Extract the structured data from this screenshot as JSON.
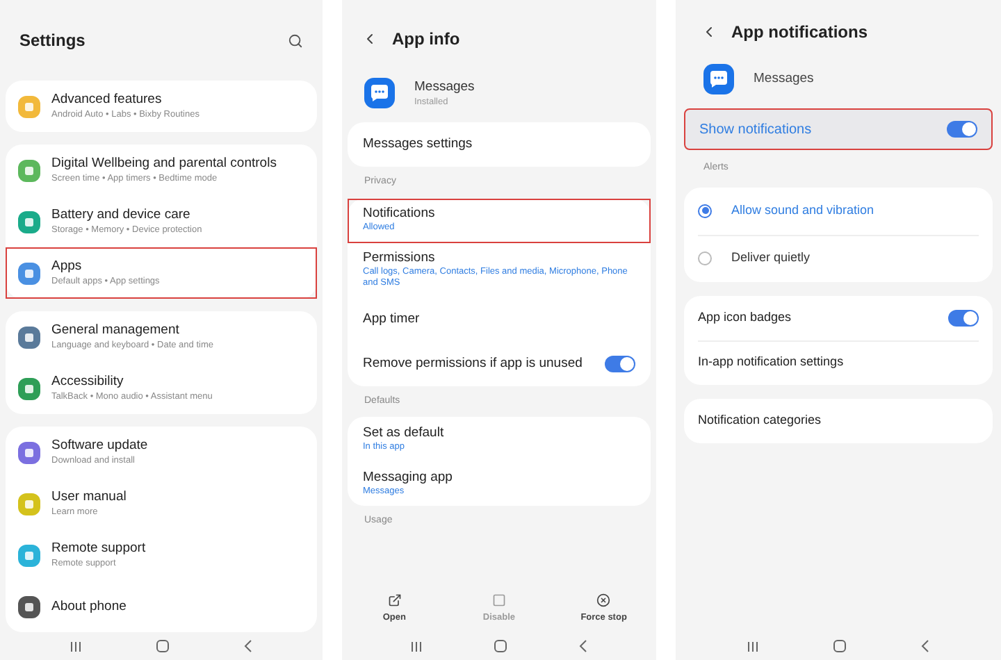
{
  "settings": {
    "title": "Settings",
    "groups": [
      [
        {
          "title": "Advanced features",
          "subtitle": "Android Auto • Labs • Bixby Routines",
          "color": "#f2b93b",
          "highlighted": false
        }
      ],
      [
        {
          "title": "Digital Wellbeing and parental controls",
          "subtitle": "Screen time • App timers • Bedtime mode",
          "color": "#5cb85c",
          "highlighted": false
        },
        {
          "title": "Battery and device care",
          "subtitle": "Storage • Memory • Device protection",
          "color": "#1aab8a",
          "highlighted": false
        },
        {
          "title": "Apps",
          "subtitle": "Default apps • App settings",
          "color": "#4a90e2",
          "highlighted": true
        }
      ],
      [
        {
          "title": "General management",
          "subtitle": "Language and keyboard • Date and time",
          "color": "#5a7a9a",
          "highlighted": false
        },
        {
          "title": "Accessibility",
          "subtitle": "TalkBack • Mono audio • Assistant menu",
          "color": "#2e9e57",
          "highlighted": false
        }
      ],
      [
        {
          "title": "Software update",
          "subtitle": "Download and install",
          "color": "#7b6fe0",
          "highlighted": false
        },
        {
          "title": "User manual",
          "subtitle": "Learn more",
          "color": "#d4c21c",
          "highlighted": false
        },
        {
          "title": "Remote support",
          "subtitle": "Remote support",
          "color": "#2bb3d9",
          "highlighted": false
        },
        {
          "title": "About phone",
          "color": "#555555",
          "highlighted": false
        }
      ]
    ]
  },
  "app_info": {
    "title": "App info",
    "app": {
      "name": "Messages",
      "status": "Installed"
    },
    "sections": [
      {
        "items": [
          {
            "kind": "link",
            "title": "Messages settings",
            "highlighted": false
          }
        ]
      },
      {
        "header": "Privacy",
        "items": [
          {
            "kind": "link",
            "title": "Notifications",
            "subtitle": "Allowed",
            "highlighted": true
          },
          {
            "kind": "link",
            "title": "Permissions",
            "subtitle": "Call logs, Camera, Contacts, Files and media, Microphone, Phone and SMS",
            "highlighted": false
          },
          {
            "kind": "link",
            "title": "App timer",
            "highlighted": false
          },
          {
            "kind": "toggle",
            "title": "Remove permissions if app is unused",
            "on": true,
            "highlighted": false
          }
        ]
      },
      {
        "header": "Defaults",
        "items": [
          {
            "kind": "link",
            "title": "Set as default",
            "subtitle": "In this app",
            "highlighted": false
          },
          {
            "kind": "link",
            "title": "Messaging app",
            "subtitle": "Messages",
            "highlighted": false
          }
        ]
      },
      {
        "header": "Usage"
      }
    ],
    "actions": [
      {
        "kind": "open",
        "label": "Open",
        "disabled": false
      },
      {
        "kind": "disable",
        "label": "Disable",
        "disabled": true
      },
      {
        "kind": "stop",
        "label": "Force stop",
        "disabled": false
      }
    ]
  },
  "app_notifications": {
    "title": "App notifications",
    "app": {
      "name": "Messages"
    },
    "master": {
      "title": "Show notifications",
      "on": true,
      "highlighted": true
    },
    "alerts_header": "Alerts",
    "alerts": [
      {
        "label": "Allow sound and vibration",
        "selected": true
      },
      {
        "label": "Deliver quietly",
        "selected": false
      }
    ],
    "sections": [
      [
        {
          "kind": "toggle",
          "title": "App icon badges",
          "on": true
        },
        {
          "kind": "link",
          "title": "In-app notification settings"
        }
      ],
      [
        {
          "kind": "link",
          "title": "Notification categories"
        }
      ]
    ]
  }
}
